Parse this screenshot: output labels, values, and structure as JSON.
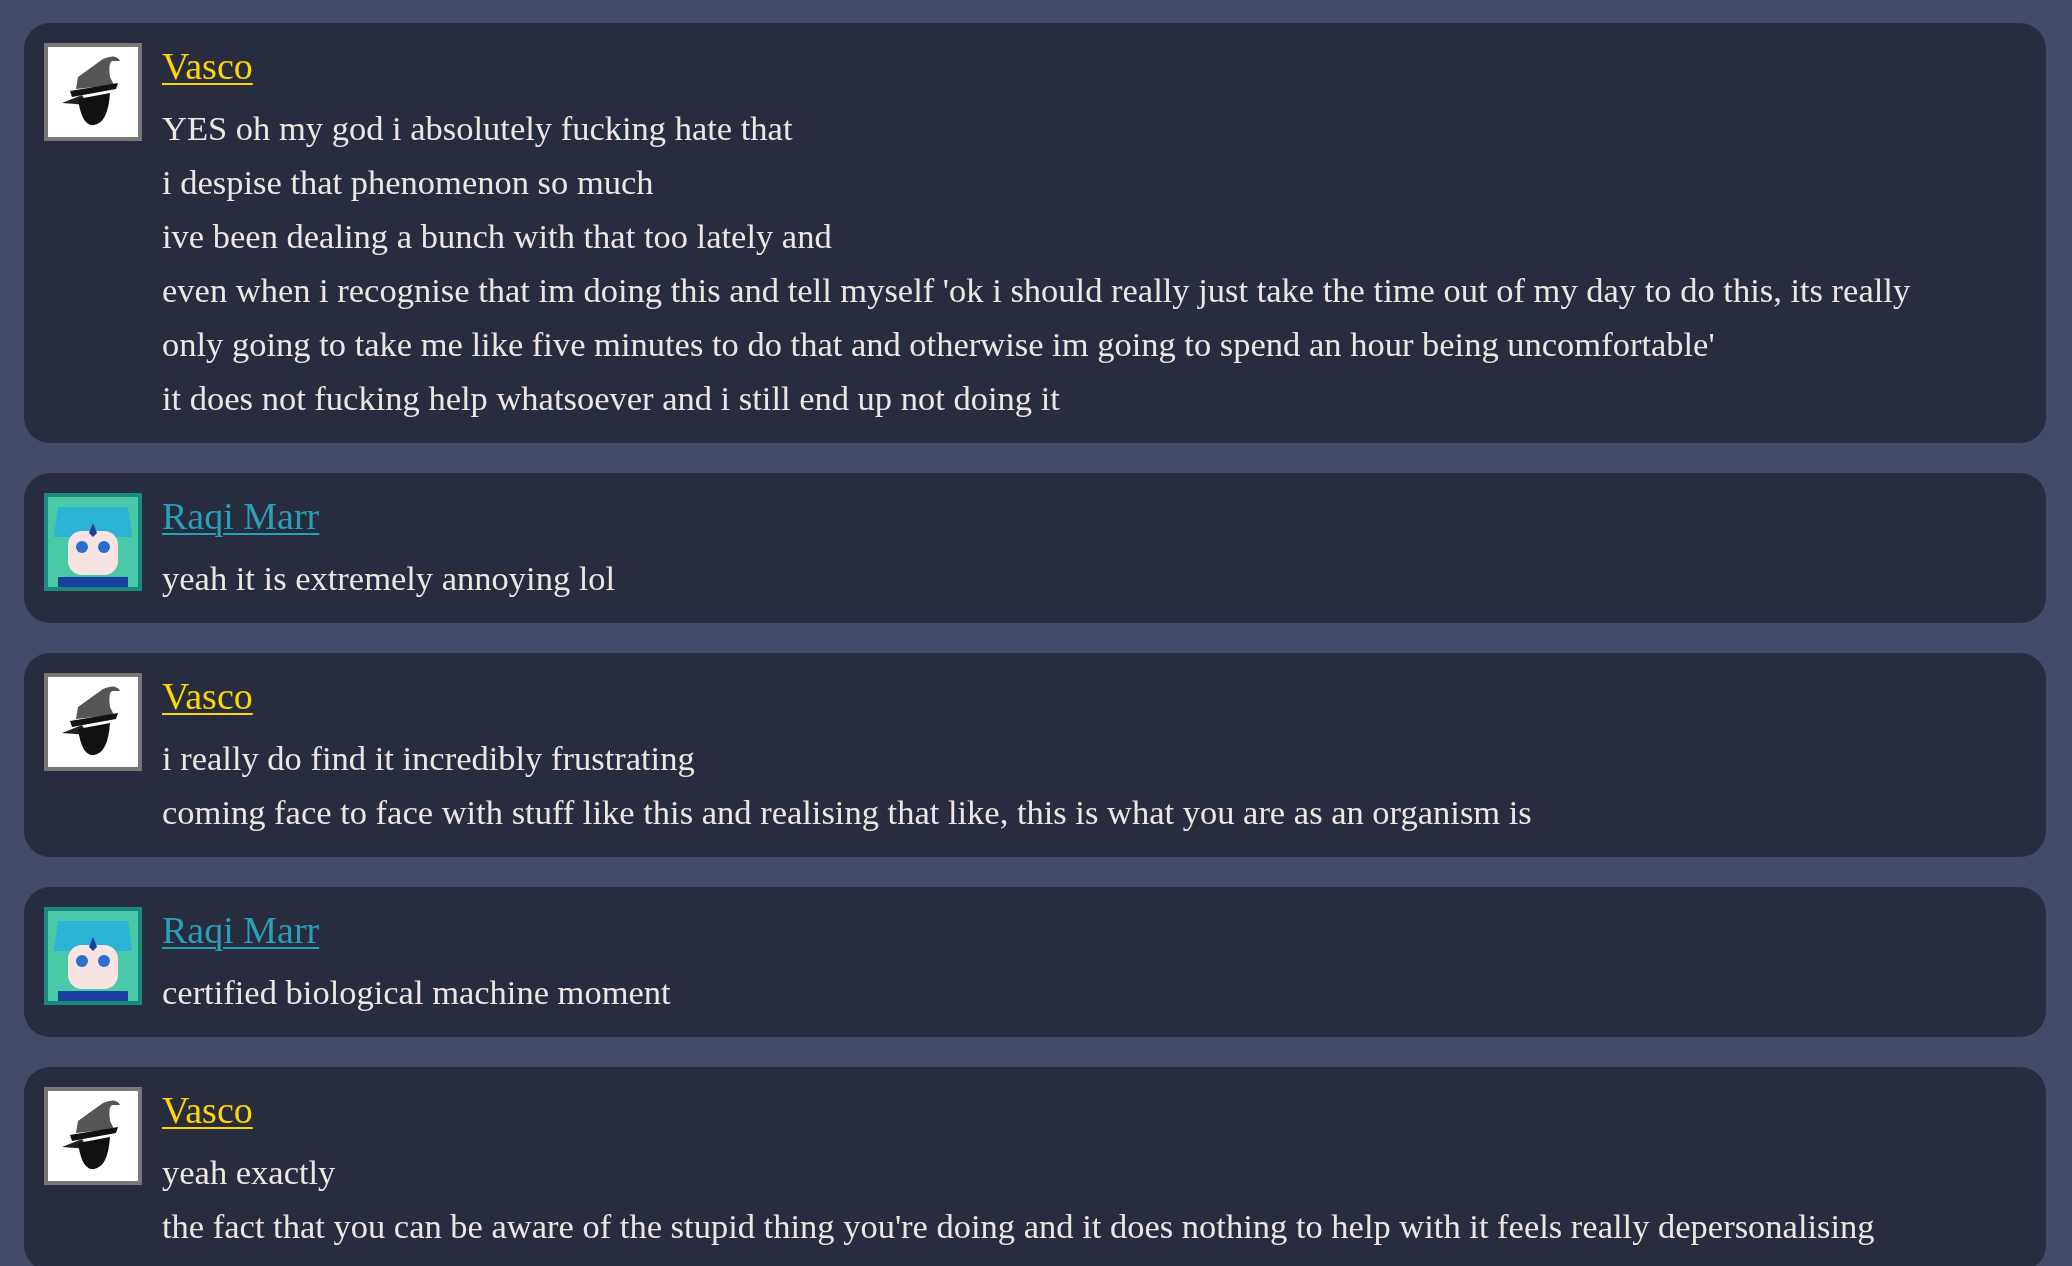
{
  "messages": [
    {
      "author": {
        "name": "Vasco",
        "color": "#ffd700",
        "kind": "hat"
      },
      "lines": [
        "YES oh my god i absolutely fucking hate that",
        "i despise that phenomenon so much",
        "ive been dealing a bunch with that too lately and",
        "even when i recognise that im doing this and tell myself 'ok i should really just take the time out of my day to do this, its really",
        "only going to take me like five minutes to do that and otherwise im going to spend an hour being uncomfortable'",
        "it does not fucking help whatsoever and i still end up not doing it"
      ]
    },
    {
      "author": {
        "name": "Raqi Marr",
        "color": "#2a9fb5",
        "kind": "green"
      },
      "lines": [
        "yeah it is extremely annoying lol"
      ]
    },
    {
      "author": {
        "name": "Vasco",
        "color": "#ffd700",
        "kind": "hat"
      },
      "lines": [
        "i really do find it incredibly frustrating",
        "coming face to face with stuff like this and realising that like, this is what you are as an organism is"
      ]
    },
    {
      "author": {
        "name": "Raqi Marr",
        "color": "#2a9fb5",
        "kind": "green"
      },
      "lines": [
        "certified biological machine moment"
      ]
    },
    {
      "author": {
        "name": "Vasco",
        "color": "#ffd700",
        "kind": "hat"
      },
      "lines": [
        "yeah exactly",
        "the fact that you can be aware of the stupid thing you're doing and it does nothing to help with it feels really depersonalising"
      ]
    }
  ]
}
